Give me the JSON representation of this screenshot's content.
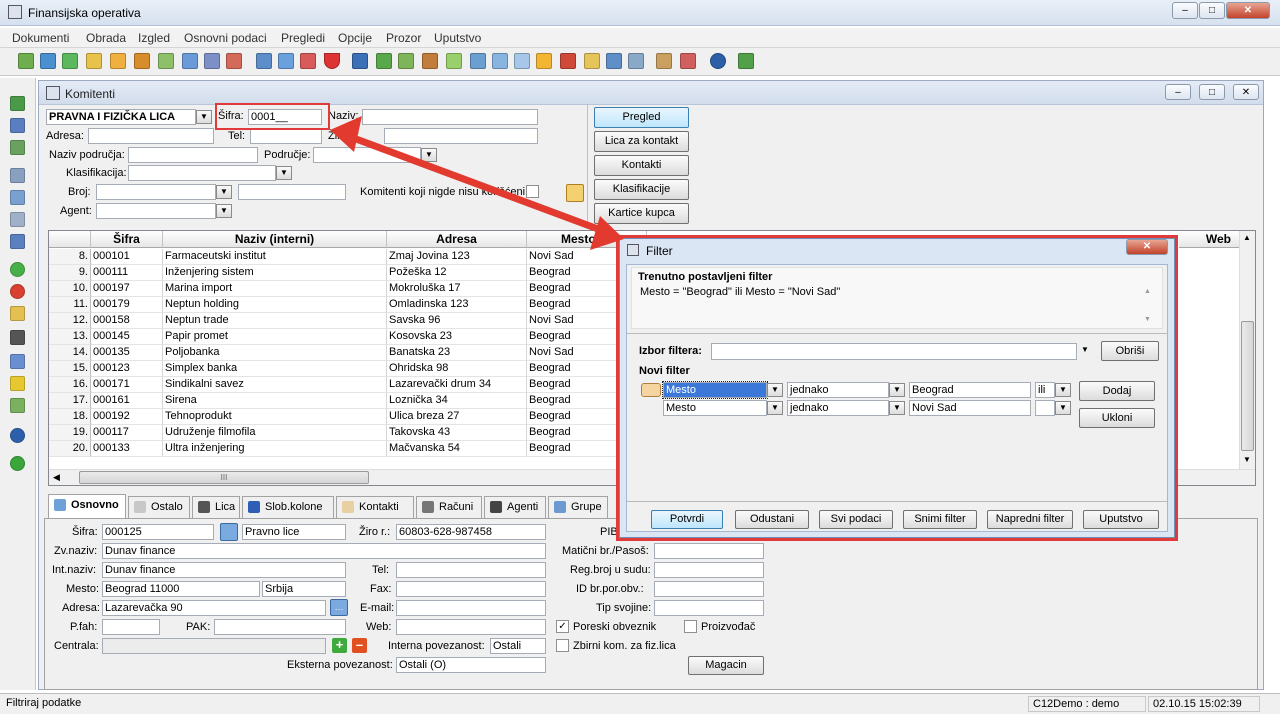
{
  "app": {
    "title": "Finansijska operativa"
  },
  "menu": [
    "Dokumenti",
    "Obrada",
    "Izgled",
    "Osnovni podaci",
    "Pregledi",
    "Opcije",
    "Prozor",
    "Uputstvo"
  ],
  "komitenti": {
    "title": "Komitenti",
    "type_select": "PRAVNA I FIZIČKA LICA",
    "labels": {
      "sifra": "Šifra:",
      "naziv": "Naziv:",
      "adresa": "Adresa:",
      "tel": "Tel:",
      "ziro": "Žiro r.:",
      "naziv_podrucja": "Naziv područja:",
      "podrucje": "Područje:",
      "klasifikacija": "Klasifikacija:",
      "broj": "Broj:",
      "agent": "Agent:",
      "nigde": "Komitenti koji nigde nisu korišćeni:"
    },
    "sifra_value": "0001__",
    "buttons": [
      "Pregled",
      "Lica za kontakt",
      "Kontakti",
      "Klasifikacije",
      "Kartice kupca"
    ]
  },
  "grid": {
    "columns": [
      "Šifra",
      "Naziv (interni)",
      "Adresa",
      "Mesto",
      "Web"
    ],
    "rows": [
      {
        "n": "8.",
        "sifra": "000101",
        "naziv": "Farmaceutski institut",
        "adresa": "Zmaj Jovina 123",
        "mesto": "Novi Sad"
      },
      {
        "n": "9.",
        "sifra": "000111",
        "naziv": "Inženjering sistem",
        "adresa": "Požeška 12",
        "mesto": "Beograd"
      },
      {
        "n": "10.",
        "sifra": "000197",
        "naziv": "Marina import",
        "adresa": "Mokroluška 17",
        "mesto": "Beograd"
      },
      {
        "n": "11.",
        "sifra": "000179",
        "naziv": "Neptun holding",
        "adresa": "Omladinska 123",
        "mesto": "Beograd"
      },
      {
        "n": "12.",
        "sifra": "000158",
        "naziv": "Neptun trade",
        "adresa": "Savska 96",
        "mesto": "Novi Sad"
      },
      {
        "n": "13.",
        "sifra": "000145",
        "naziv": "Papir promet",
        "adresa": "Kosovska 23",
        "mesto": "Beograd"
      },
      {
        "n": "14.",
        "sifra": "000135",
        "naziv": "Poljobanka",
        "adresa": "Banatska 23",
        "mesto": "Novi Sad"
      },
      {
        "n": "15.",
        "sifra": "000123",
        "naziv": "Simplex banka",
        "adresa": "Ohridska 98",
        "mesto": "Beograd"
      },
      {
        "n": "16.",
        "sifra": "000171",
        "naziv": "Sindikalni savez",
        "adresa": "Lazarevački drum 34",
        "mesto": "Beograd"
      },
      {
        "n": "17.",
        "sifra": "000161",
        "naziv": "Sirena",
        "adresa": "Loznička 34",
        "mesto": "Beograd"
      },
      {
        "n": "18.",
        "sifra": "000192",
        "naziv": "Tehnoprodukt",
        "adresa": "Ulica breza 27",
        "mesto": "Beograd"
      },
      {
        "n": "19.",
        "sifra": "000117",
        "naziv": "Udruženje filmofila",
        "adresa": "Takovska 43",
        "mesto": "Beograd"
      },
      {
        "n": "20.",
        "sifra": "000133",
        "naziv": "Ultra inženjering",
        "adresa": "Mačvanska 54",
        "mesto": "Beograd"
      }
    ],
    "hscroll_glyph": "III"
  },
  "tabs": [
    "Osnovno",
    "Ostalo",
    "Lica",
    "Slob.kolone",
    "Kontakti",
    "Računi",
    "Agenti",
    "Grupe"
  ],
  "detail": {
    "sifra_label": "Šifra:",
    "sifra": "000125",
    "tip": "Pravno lice",
    "ziro_label": "Žiro r.:",
    "ziro": "60803-628-987458",
    "pib_label": "PIB",
    "zvnaziv_label": "Zv.naziv:",
    "zvnaziv": "Dunav finance",
    "maticni_label": "Matični br./Pasoš:",
    "intnaziv_label": "Int.naziv:",
    "intnaziv": "Dunav finance",
    "tel_label": "Tel:",
    "regbroj_label": "Reg.broj u sudu:",
    "mesto_label": "Mesto:",
    "mesto": "Beograd  11000",
    "drzava": "Srbija",
    "fax_label": "Fax:",
    "idbr_label": "ID br.por.obv.:",
    "adresa_label": "Adresa:",
    "adresa": "Lazarevačka 90",
    "email_label": "E-mail:",
    "tip_svojine_label": "Tip svojine:",
    "pfah_label": "P.fah:",
    "pak_label": "PAK:",
    "web_label": "Web:",
    "poreski": "Poreski obveznik",
    "proizvodjac": "Proizvođač",
    "centrala_label": "Centrala:",
    "interna_label": "Interna povezanost:",
    "interna": "Ostali",
    "zbirni": "Zbirni kom. za fiz.lica",
    "eksterna_label": "Eksterna povezanost:",
    "eksterna": "Ostali (O)",
    "magacin": "Magacin"
  },
  "filter": {
    "title": "Filter",
    "current_label": "Trenutno postavljeni filter",
    "current_value": "Mesto = \"Beograd\"  ili  Mesto = \"Novi Sad\"",
    "izbor_label": "Izbor filtera:",
    "obrisi": "Obriši",
    "novi_label": "Novi filter",
    "rows": [
      {
        "field": "Mesto",
        "op": "jednako",
        "value": "Beograd",
        "conj": "ili"
      },
      {
        "field": "Mesto",
        "op": "jednako",
        "value": "Novi Sad",
        "conj": ""
      }
    ],
    "dodaj": "Dodaj",
    "ukloni": "Ukloni",
    "buttons": [
      "Potvrdi",
      "Odustani",
      "Svi podaci",
      "Snimi filter",
      "Napredni filter",
      "Uputstvo"
    ]
  },
  "status": {
    "left": "Filtriraj podatke",
    "user": "C12Demo : demo",
    "datetime": "02.10.15 15:02:39"
  }
}
